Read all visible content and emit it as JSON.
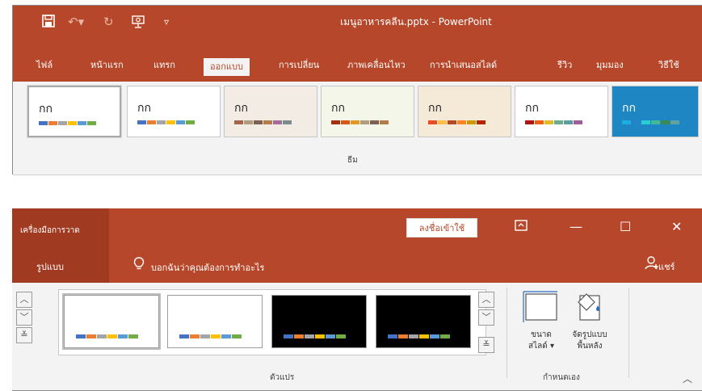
{
  "window1": {
    "title": "เมนูอาหารคลีน.pptx  -  PowerPoint",
    "qat": [
      "save-icon",
      "undo-icon",
      "redo-icon",
      "present-icon",
      "customize-qat-icon"
    ],
    "tabs": [
      {
        "label": "ไฟล์"
      },
      {
        "label": "หน้าแรก"
      },
      {
        "label": "แทรก"
      },
      {
        "label": "ออกแบบ"
      },
      {
        "label": "การเปลี่ยน"
      },
      {
        "label": "ภาพเคลื่อนไหว"
      },
      {
        "label": "การนำเสนอสไลด์"
      },
      {
        "label": "รีวิว"
      },
      {
        "label": "มุมมอง"
      },
      {
        "label": "วิธีใช้"
      }
    ],
    "themes_group_label": "ธีม",
    "themes": [
      {
        "text": "กก",
        "bg": "#ffffff",
        "colors": [
          "#4472c4",
          "#ed7d31",
          "#a5a5a5",
          "#ffc000",
          "#5b9bd5",
          "#70ad47"
        ]
      },
      {
        "text": "กก",
        "bg": "#ffffff",
        "colors": [
          "#4472c4",
          "#ed7d31",
          "#a5a5a5",
          "#ffc000",
          "#5b9bd5",
          "#70ad47"
        ]
      },
      {
        "text": "กก",
        "bg": "#f2ece4",
        "colors": [
          "#a5644e",
          "#b19c7d",
          "#7f5f52",
          "#b27d49",
          "#a66d9b",
          "#7a8c8e"
        ]
      },
      {
        "text": "กก",
        "bg": "#f4f6ea",
        "colors": [
          "#a5300f",
          "#d55816",
          "#e19825",
          "#b19c7d",
          "#7f5f52",
          "#b27d49"
        ]
      },
      {
        "text": "กก",
        "bg": "#f5e9d8",
        "colors": [
          "#e84c22",
          "#ffbd47",
          "#b64926",
          "#ff8427",
          "#cc9900",
          "#b22600"
        ]
      },
      {
        "text": "กก",
        "bg": "#ffffff",
        "colors": [
          "#b01513",
          "#ea6312",
          "#e6b729",
          "#6aac90",
          "#5f9c9d",
          "#9e5e9b"
        ]
      },
      {
        "text": "กก",
        "bg": "#1f86c4",
        "colors": [
          "#1cade4",
          "#2683c6",
          "#27ced7",
          "#42ba97",
          "#3e8853",
          "#62a39f"
        ]
      }
    ]
  },
  "window2": {
    "context_tab": "เครื่องมือการวาด",
    "format_tab": "รูปแบบ",
    "tell_me": "บอกฉันว่าคุณต้องการทำอะไร",
    "signin": "ลงชื่อเข้าใช้",
    "share": "แชร์",
    "window_controls": [
      "ribbon-display-icon",
      "minimize-icon",
      "maximize-icon",
      "close-icon"
    ],
    "variants_group_label": "ตัวแปร",
    "variants": [
      {
        "bg": "#ffffff",
        "colors": [
          "#4472c4",
          "#ed7d31",
          "#a5a5a5",
          "#ffc000",
          "#5b9bd5",
          "#70ad47"
        ]
      },
      {
        "bg": "#ffffff",
        "colors": [
          "#4472c4",
          "#ed7d31",
          "#a5a5a5",
          "#ffc000",
          "#5b9bd5",
          "#70ad47"
        ]
      },
      {
        "bg": "#000000",
        "colors": [
          "#4472c4",
          "#ed7d31",
          "#a5a5a5",
          "#ffc000",
          "#5b9bd5",
          "#70ad47"
        ]
      },
      {
        "bg": "#000000",
        "colors": [
          "#4472c4",
          "#ed7d31",
          "#a5a5a5",
          "#ffc000",
          "#5b9bd5",
          "#70ad47"
        ]
      }
    ],
    "slide_size_label_1": "ขนาด",
    "slide_size_label_2": "สไลด์ ▾",
    "format_bg_label_1": "จัดรูปแบบ",
    "format_bg_label_2": "พื้นหลัง",
    "customize_group_label": "กำหนดเอง"
  },
  "colors": {
    "accent": "#b7472a",
    "context": "#a03b22",
    "ribbon": "#f3f3f3"
  }
}
